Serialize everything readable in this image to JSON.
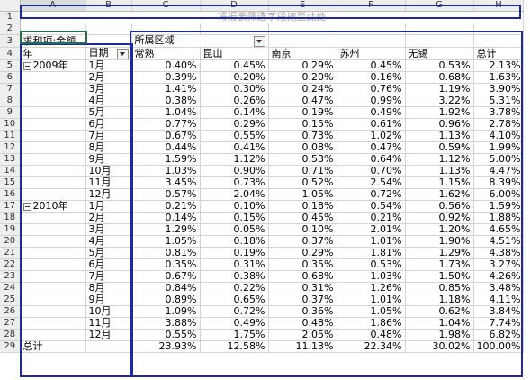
{
  "columns": [
    "A",
    "B",
    "C",
    "D",
    "E",
    "F",
    "G",
    "H"
  ],
  "drop_zone": "将报表筛选字段拖至此处",
  "pivot": {
    "data_label": "求和项:金额",
    "col_field": "所属区域",
    "row_field_year": "年",
    "row_field_date": "日期",
    "regions": [
      "常熟",
      "昆山",
      "南京",
      "苏州",
      "无锡",
      "总计"
    ],
    "groups": [
      {
        "year": "2009年",
        "months": [
          {
            "m": "1月",
            "v": [
              "0.40%",
              "0.45%",
              "0.29%",
              "0.45%",
              "0.53%",
              "2.13%"
            ]
          },
          {
            "m": "2月",
            "v": [
              "0.39%",
              "0.20%",
              "0.20%",
              "0.16%",
              "0.68%",
              "1.63%"
            ]
          },
          {
            "m": "3月",
            "v": [
              "1.41%",
              "0.30%",
              "0.24%",
              "0.76%",
              "1.19%",
              "3.90%"
            ]
          },
          {
            "m": "4月",
            "v": [
              "0.38%",
              "0.26%",
              "0.47%",
              "0.99%",
              "3.22%",
              "5.31%"
            ]
          },
          {
            "m": "5月",
            "v": [
              "1.04%",
              "0.14%",
              "0.19%",
              "0.49%",
              "1.92%",
              "3.78%"
            ]
          },
          {
            "m": "6月",
            "v": [
              "0.77%",
              "0.29%",
              "0.15%",
              "0.61%",
              "0.96%",
              "2.78%"
            ]
          },
          {
            "m": "7月",
            "v": [
              "0.67%",
              "0.55%",
              "0.73%",
              "1.02%",
              "1.13%",
              "4.10%"
            ]
          },
          {
            "m": "8月",
            "v": [
              "0.44%",
              "0.41%",
              "0.08%",
              "0.47%",
              "0.59%",
              "1.99%"
            ]
          },
          {
            "m": "9月",
            "v": [
              "1.59%",
              "1.12%",
              "0.53%",
              "0.64%",
              "1.12%",
              "5.00%"
            ]
          },
          {
            "m": "10月",
            "v": [
              "1.03%",
              "0.90%",
              "0.71%",
              "0.70%",
              "1.13%",
              "4.47%"
            ]
          },
          {
            "m": "11月",
            "v": [
              "3.45%",
              "0.73%",
              "0.52%",
              "2.54%",
              "1.15%",
              "8.39%"
            ]
          },
          {
            "m": "12月",
            "v": [
              "0.57%",
              "2.04%",
              "1.05%",
              "0.72%",
              "1.62%",
              "6.00%"
            ]
          }
        ]
      },
      {
        "year": "2010年",
        "months": [
          {
            "m": "1月",
            "v": [
              "0.21%",
              "0.10%",
              "0.18%",
              "0.54%",
              "0.56%",
              "1.59%"
            ]
          },
          {
            "m": "2月",
            "v": [
              "0.14%",
              "0.15%",
              "0.45%",
              "0.21%",
              "0.92%",
              "1.88%"
            ]
          },
          {
            "m": "3月",
            "v": [
              "1.29%",
              "0.05%",
              "0.10%",
              "2.01%",
              "1.20%",
              "4.65%"
            ]
          },
          {
            "m": "4月",
            "v": [
              "1.05%",
              "0.18%",
              "0.37%",
              "1.01%",
              "1.90%",
              "4.51%"
            ]
          },
          {
            "m": "5月",
            "v": [
              "0.81%",
              "0.19%",
              "0.29%",
              "1.81%",
              "1.29%",
              "4.38%"
            ]
          },
          {
            "m": "6月",
            "v": [
              "0.35%",
              "0.31%",
              "0.35%",
              "0.53%",
              "1.73%",
              "3.27%"
            ]
          },
          {
            "m": "7月",
            "v": [
              "0.67%",
              "0.38%",
              "0.68%",
              "1.03%",
              "1.50%",
              "4.26%"
            ]
          },
          {
            "m": "8月",
            "v": [
              "0.84%",
              "0.22%",
              "0.31%",
              "1.26%",
              "0.85%",
              "3.48%"
            ]
          },
          {
            "m": "9月",
            "v": [
              "0.89%",
              "0.65%",
              "0.37%",
              "1.01%",
              "1.18%",
              "4.11%"
            ]
          },
          {
            "m": "10月",
            "v": [
              "1.09%",
              "0.72%",
              "0.36%",
              "1.05%",
              "0.62%",
              "3.84%"
            ]
          },
          {
            "m": "11月",
            "v": [
              "3.88%",
              "0.49%",
              "0.48%",
              "1.86%",
              "1.04%",
              "7.74%"
            ]
          },
          {
            "m": "12月",
            "v": [
              "0.55%",
              "1.75%",
              "2.05%",
              "0.48%",
              "1.98%",
              "6.82%"
            ]
          }
        ]
      }
    ],
    "grand_total_label": "总计",
    "grand_total": [
      "23.93%",
      "12.58%",
      "11.13%",
      "22.34%",
      "30.02%",
      "100.00%"
    ]
  }
}
